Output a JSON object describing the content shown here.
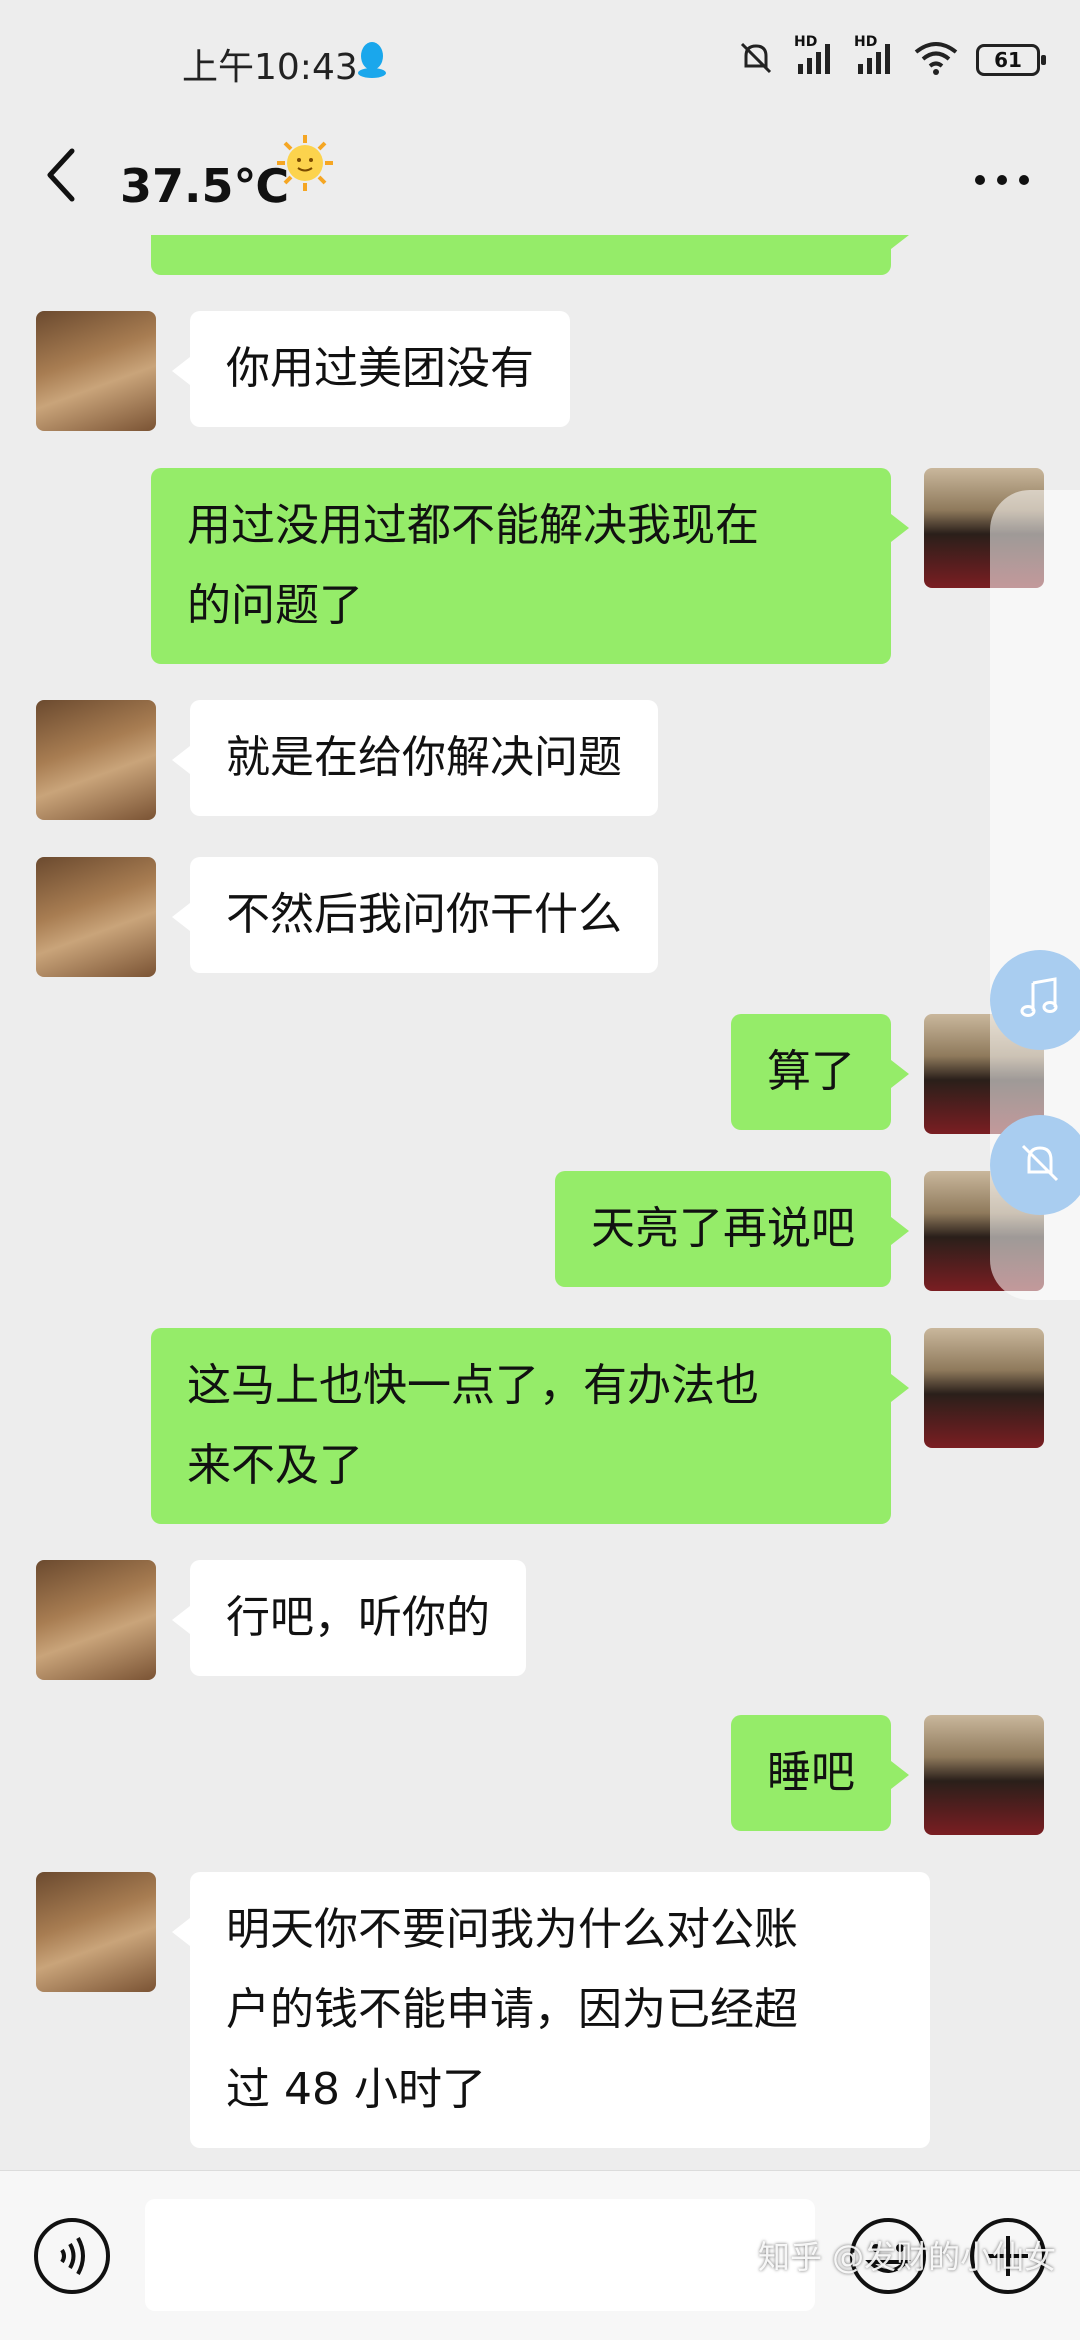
{
  "status_bar": {
    "time": "上午10:43",
    "signal_label_1": "HD",
    "signal_label_2": "HD",
    "battery": "61"
  },
  "header": {
    "title": "37.5℃",
    "title_emoji": "sun-with-face-icon"
  },
  "messages": [
    {
      "side": "right",
      "text": ""
    },
    {
      "side": "left",
      "text": "你用过美团没有"
    },
    {
      "side": "right",
      "line1": "用过没用过都不能解决我现在",
      "line2": "的问题了"
    },
    {
      "side": "left",
      "text": "就是在给你解决问题"
    },
    {
      "side": "left",
      "text": "不然后我问你干什么"
    },
    {
      "side": "right",
      "text": "算了"
    },
    {
      "side": "right",
      "text": "天亮了再说吧"
    },
    {
      "side": "right",
      "line1": "这马上也快一点了，有办法也",
      "line2": "来不及了"
    },
    {
      "side": "left",
      "text": "行吧，听你的"
    },
    {
      "side": "right",
      "text": "睡吧"
    },
    {
      "side": "left",
      "line1": "明天你不要问我为什么对公账",
      "line2": "户的钱不能申请，因为已经超",
      "line3": "过 48 小时了"
    }
  ],
  "watermark": "知乎 @发财的小仙女",
  "colors": {
    "background": "#ededed",
    "self_bubble": "#95ec69",
    "other_bubble": "#ffffff"
  }
}
